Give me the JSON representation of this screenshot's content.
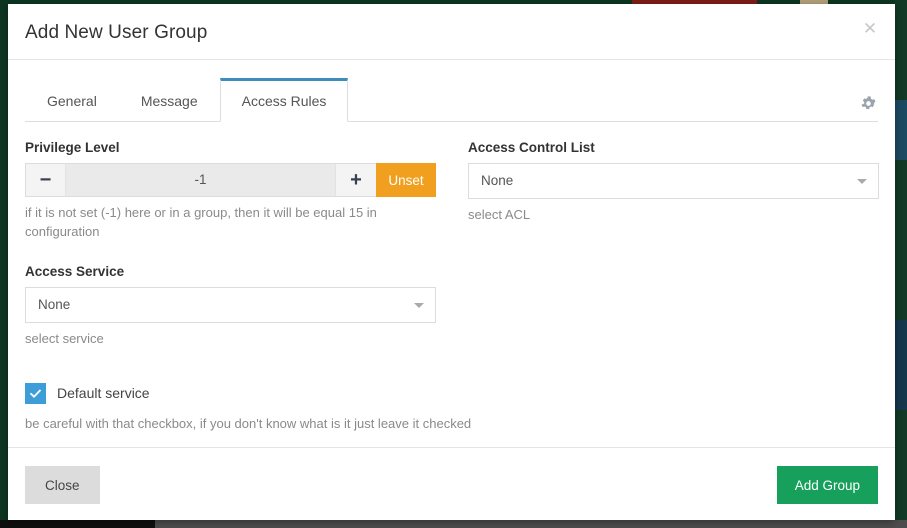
{
  "modal": {
    "title": "Add New User Group",
    "close_icon": "close-icon",
    "close_glyph": "✕"
  },
  "tabs": [
    {
      "label": "General",
      "active": false
    },
    {
      "label": "Message",
      "active": false
    },
    {
      "label": "Access Rules",
      "active": true
    }
  ],
  "settings_icon": "gear-icon",
  "privilege_level": {
    "label": "Privilege Level",
    "decrement_glyph": "−",
    "increment_glyph": "+",
    "value": "-1",
    "unset_label": "Unset",
    "help": "if it is not set (-1) here or in a group, then it will be equal 15 in configuration"
  },
  "access_control_list": {
    "label": "Access Control List",
    "value": "None",
    "help": "select ACL"
  },
  "access_service": {
    "label": "Access Service",
    "value": "None",
    "help": "select service"
  },
  "default_service": {
    "label": "Default service",
    "checked": true,
    "check_glyph": "✔",
    "help": "be careful with that checkbox, if you don't know what is it just leave it checked"
  },
  "footer": {
    "close_label": "Close",
    "submit_label": "Add Group"
  },
  "colors": {
    "accent_blue": "#3c8dbc",
    "unset_orange": "#f0a01e",
    "submit_green": "#16a05c",
    "checkbox_blue": "#3c9dd8"
  }
}
